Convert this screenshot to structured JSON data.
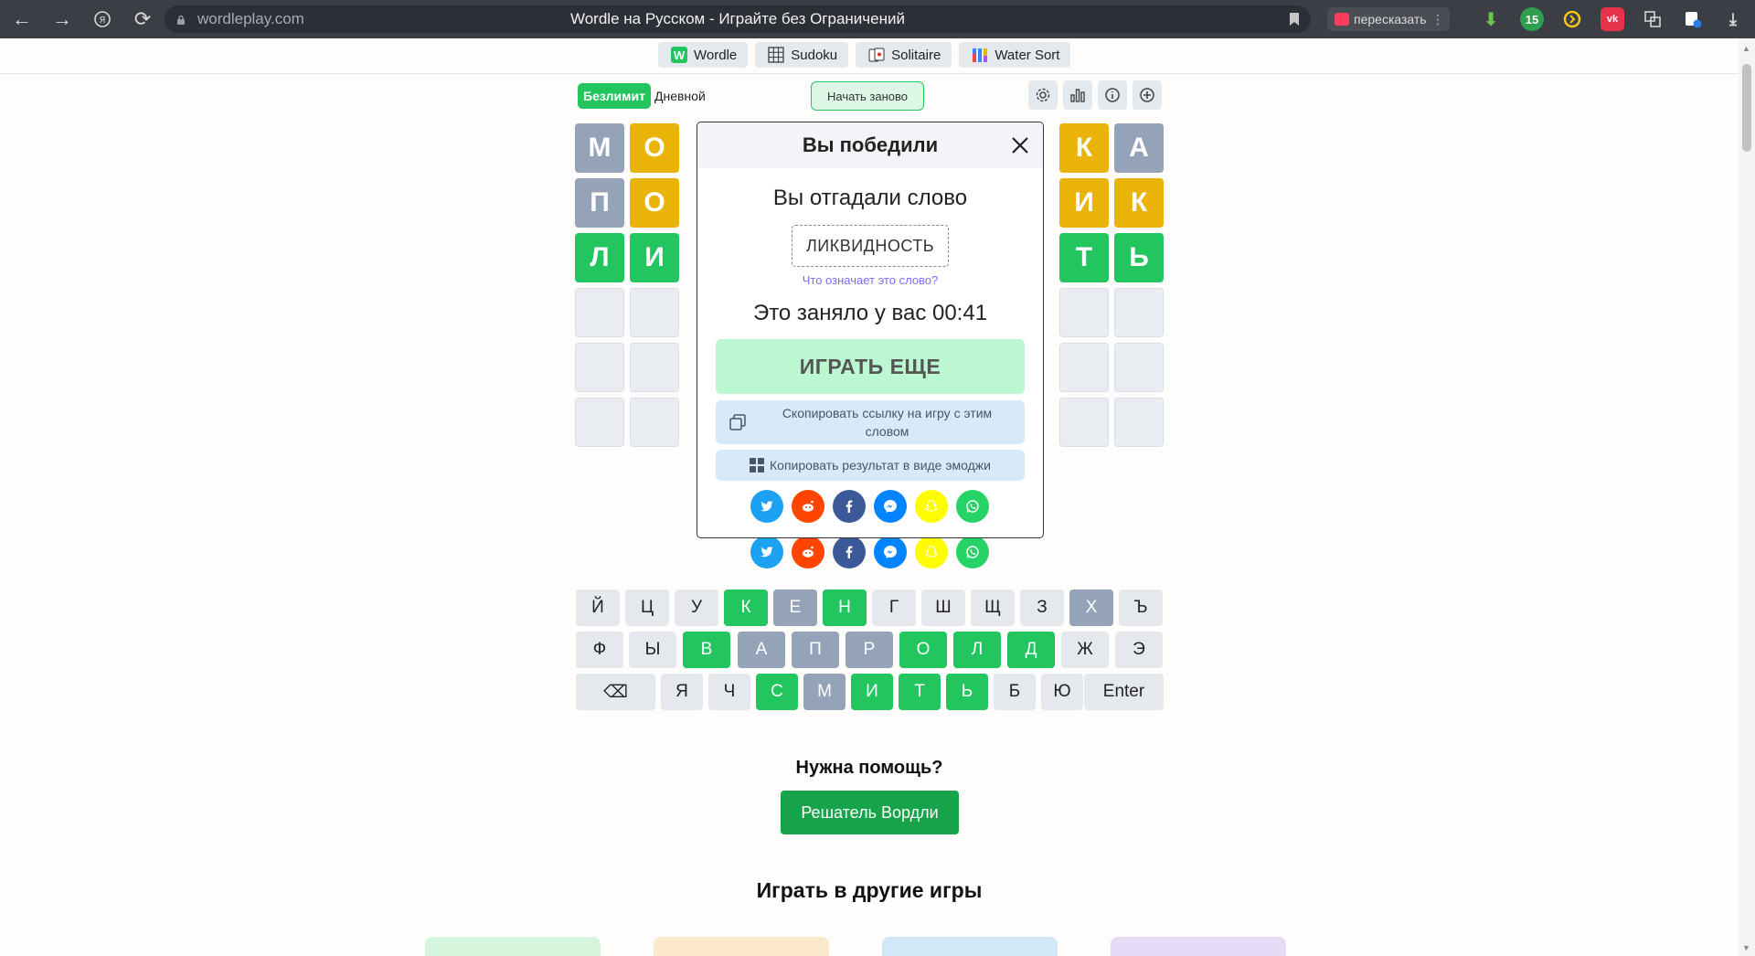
{
  "browser": {
    "url": "wordleplay.com",
    "page_title": "Wordle на Русском - Играйте без Ограничений",
    "retell_label": "пересказать",
    "ext_badge": "15"
  },
  "game_tabs": [
    {
      "label": "Wordle",
      "icon": "wordle-logo-icon"
    },
    {
      "label": "Sudoku",
      "icon": "grid-icon"
    },
    {
      "label": "Solitaire",
      "icon": "cards-icon"
    },
    {
      "label": "Water Sort",
      "icon": "tubes-icon"
    }
  ],
  "controls": {
    "mode_unlimited": "Безлимит",
    "mode_daily": "Дневной",
    "restart": "Начать заново",
    "icons": [
      "gear-icon",
      "chart-icon",
      "info-icon",
      "plus-icon"
    ]
  },
  "board": {
    "rows": [
      {
        "letters": [
          "М",
          "О",
          "",
          "",
          "",
          "",
          "",
          "",
          "К",
          "А"
        ],
        "states": [
          "gray",
          "yellow",
          "",
          "",
          "",
          "",
          "",
          "",
          "yellow",
          "gray"
        ]
      },
      {
        "letters": [
          "П",
          "О",
          "",
          "",
          "",
          "",
          "",
          "",
          "И",
          "К"
        ],
        "states": [
          "gray",
          "yellow",
          "",
          "",
          "",
          "",
          "",
          "",
          "yellow",
          "yellow"
        ]
      },
      {
        "letters": [
          "Л",
          "И",
          "",
          "",
          "",
          "",
          "",
          "",
          "Т",
          "Ь"
        ],
        "states": [
          "green",
          "green",
          "",
          "",
          "",
          "",
          "",
          "",
          "green",
          "green"
        ]
      },
      {
        "letters": [
          "",
          "",
          "",
          "",
          "",
          "",
          "",
          "",
          "",
          ""
        ],
        "states": [
          "empty",
          "empty",
          "",
          "",
          "",
          "",
          "",
          "",
          "empty",
          "empty"
        ]
      },
      {
        "letters": [
          "",
          "",
          "",
          "",
          "",
          "",
          "",
          "",
          "",
          ""
        ],
        "states": [
          "empty",
          "empty",
          "",
          "",
          "",
          "",
          "",
          "",
          "empty",
          "empty"
        ]
      },
      {
        "letters": [
          "",
          "",
          "",
          "",
          "",
          "",
          "",
          "",
          "",
          ""
        ],
        "states": [
          "empty",
          "empty",
          "",
          "",
          "",
          "",
          "",
          "",
          "empty",
          "empty"
        ]
      }
    ]
  },
  "share_buttons": [
    {
      "name": "twitter",
      "color": "#1da1f2"
    },
    {
      "name": "reddit",
      "color": "#ff4500"
    },
    {
      "name": "facebook",
      "color": "#3b5998"
    },
    {
      "name": "messenger",
      "color": "#0084ff"
    },
    {
      "name": "snapchat",
      "color": "#fffc00"
    },
    {
      "name": "whatsapp",
      "color": "#25d366"
    }
  ],
  "keyboard": {
    "rows": [
      [
        {
          "k": "Й",
          "s": ""
        },
        {
          "k": "Ц",
          "s": ""
        },
        {
          "k": "У",
          "s": ""
        },
        {
          "k": "К",
          "s": "green"
        },
        {
          "k": "Е",
          "s": "gray"
        },
        {
          "k": "Н",
          "s": "green"
        },
        {
          "k": "Г",
          "s": ""
        },
        {
          "k": "Ш",
          "s": ""
        },
        {
          "k": "Щ",
          "s": ""
        },
        {
          "k": "З",
          "s": ""
        },
        {
          "k": "Х",
          "s": "gray"
        },
        {
          "k": "Ъ",
          "s": ""
        }
      ],
      [
        {
          "k": "Ф",
          "s": ""
        },
        {
          "k": "Ы",
          "s": ""
        },
        {
          "k": "В",
          "s": "green"
        },
        {
          "k": "А",
          "s": "gray"
        },
        {
          "k": "П",
          "s": "gray"
        },
        {
          "k": "Р",
          "s": "gray"
        },
        {
          "k": "О",
          "s": "green"
        },
        {
          "k": "Л",
          "s": "green"
        },
        {
          "k": "Д",
          "s": "green"
        },
        {
          "k": "Ж",
          "s": ""
        },
        {
          "k": "Э",
          "s": ""
        }
      ],
      [
        {
          "k": "⌫",
          "s": ""
        },
        {
          "k": "Я",
          "s": ""
        },
        {
          "k": "Ч",
          "s": ""
        },
        {
          "k": "С",
          "s": "green"
        },
        {
          "k": "М",
          "s": "gray"
        },
        {
          "k": "И",
          "s": "green"
        },
        {
          "k": "Т",
          "s": "green"
        },
        {
          "k": "Ь",
          "s": "green"
        },
        {
          "k": "Б",
          "s": ""
        },
        {
          "k": "Ю",
          "s": ""
        },
        {
          "k": "Enter",
          "s": ""
        }
      ]
    ]
  },
  "help": {
    "title": "Нужна помощь?",
    "solver_button": "Решатель Вордли",
    "other_games_title": "Играть в другие игры"
  },
  "modal": {
    "title": "Вы победили",
    "guessed_text": "Вы отгадали слово",
    "word": "ЛИКВИДНОСТЬ",
    "meaning_link": "Что означает это слово?",
    "time_text": "Это заняло у вас 00:41",
    "play_again": "ИГРАТЬ ЕЩЕ",
    "copy_link": "Скопировать ссылку на игру с этим словом",
    "copy_emoji": "Копировать результат в виде эмоджи"
  },
  "colors": {
    "green": "#22c55e",
    "yellow": "#eab308",
    "gray": "#94a3b8",
    "empty": "#e9edf2"
  }
}
